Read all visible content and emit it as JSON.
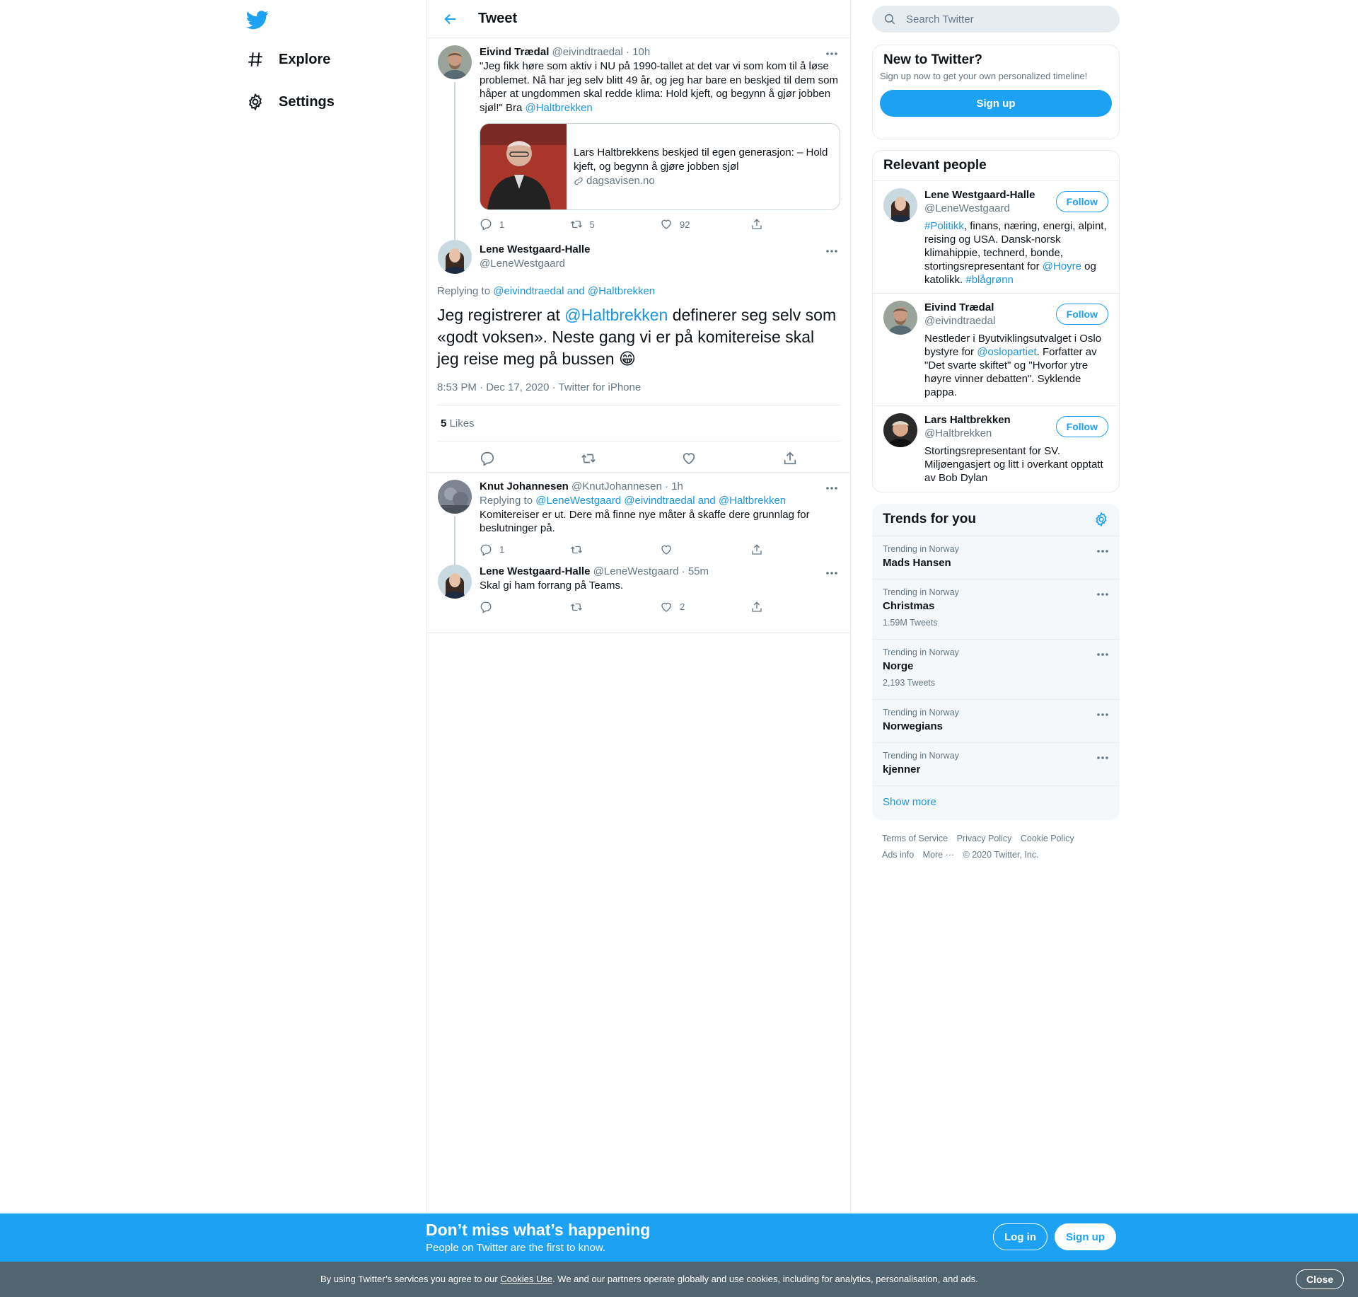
{
  "colors": {
    "accent": "#1da1f2",
    "link": "#1b95e0",
    "muted": "#657786",
    "border": "#e6ecf0",
    "cookie_bg": "#536471"
  },
  "nav": {
    "logo_icon": "twitter-bird-icon",
    "items": [
      {
        "label": "Explore",
        "icon": "hashtag-icon"
      },
      {
        "label": "Settings",
        "icon": "gear-icon"
      }
    ]
  },
  "header": {
    "title": "Tweet",
    "back_icon": "arrow-left-icon"
  },
  "parent_tweet": {
    "name": "Eivind Trædal",
    "handle": "@eivindtraedal",
    "time": "10h",
    "text": "\"Jeg fikk høre som aktiv i NU på 1990-tallet at det var vi som kom til å løse problemet. Nå har jeg selv blitt 49 år, og jeg har bare en beskjed til dem som håper at ungdommen skal redde klima: Hold kjeft, og begynn å gjør jobben sjøl!\" Bra ",
    "mention": "@Haltbrekken",
    "card": {
      "title": "Lars Haltbrekkens beskjed til egen generasjon: – Hold kjeft, og begynn å gjøre jobben sjøl",
      "domain": "dagsavisen.no"
    },
    "replies": "1",
    "retweets": "5",
    "likes": "92"
  },
  "focal_tweet": {
    "name": "Lene Westgaard-Halle",
    "handle": "@LeneWestgaard",
    "replying_prefix": "Replying to ",
    "replying_to": "@eivindtraedal and @Haltbrekken",
    "text_before": "Jeg registrerer at ",
    "mention": "@Haltbrekken",
    "text_after": " definerer seg selv som «godt voksen». Neste gang vi er på komitereise skal jeg reise meg på bussen ",
    "emoji": "😁",
    "timestamp": "8:53 PM · Dec 17, 2020 · Twitter for iPhone",
    "likes_count": "5",
    "likes_label": "Likes"
  },
  "replies": [
    {
      "name": "Knut Johannesen",
      "handle": "@KnutJohannesen",
      "time": "1h",
      "replying_prefix": "Replying to ",
      "replying_to": "@LeneWestgaard @eivindtraedal and @Haltbrekken",
      "text": "Komitereiser er ut. Dere må finne nye måter å skaffe dere grunnlag for beslutninger på.",
      "replies": "1",
      "retweets": "",
      "likes": ""
    },
    {
      "name": "Lene Westgaard-Halle",
      "handle": "@LeneWestgaard",
      "time": "55m",
      "text": "Skal gi ham forrang på Teams.",
      "replies": "",
      "retweets": "",
      "likes": "2"
    }
  ],
  "search": {
    "placeholder": "Search Twitter"
  },
  "new_to_twitter": {
    "title": "New to Twitter?",
    "subtitle": "Sign up now to get your own personalized timeline!",
    "button": "Sign up"
  },
  "relevant_people": {
    "title": "Relevant people",
    "follow_label": "Follow",
    "people": [
      {
        "name": "Lene Westgaard-Halle",
        "handle": "@LeneWestgaard",
        "bio_parts": [
          "#Politikk",
          ", finans, næring, energi, alpint, reising og USA. Dansk-norsk klimahippie, technerd, bonde, stortingsrepresentant for ",
          "@Hoyre",
          " og katolikk. ",
          "#blågrønn"
        ]
      },
      {
        "name": "Eivind Trædal",
        "handle": "@eivindtraedal",
        "bio_parts": [
          "Nestleder i Byutviklingsutvalget i Oslo bystyre for ",
          "@oslopartiet",
          ". Forfatter av \"Det svarte skiftet\" og \"Hvorfor ytre høyre vinner debatten\". Syklende pappa."
        ]
      },
      {
        "name": "Lars Haltbrekken",
        "handle": "@Haltbrekken",
        "bio": "Stortingsrepresentant for SV. Miljøengasjert og litt i overkant opptatt av Bob Dylan"
      }
    ]
  },
  "trends": {
    "title": "Trends for you",
    "items": [
      {
        "context": "Trending in Norway",
        "name": "Mads Hansen",
        "count": ""
      },
      {
        "context": "Trending in Norway",
        "name": "Christmas",
        "count": "1.59M Tweets"
      },
      {
        "context": "Trending in Norway",
        "name": "Norge",
        "count": "2,193 Tweets"
      },
      {
        "context": "Trending in Norway",
        "name": "Norwegians",
        "count": ""
      },
      {
        "context": "Trending in Norway",
        "name": "kjenner",
        "count": ""
      }
    ],
    "show_more": "Show more"
  },
  "footer": {
    "links": [
      "Terms of Service",
      "Privacy Policy",
      "Cookie Policy",
      "Ads info",
      "More ···"
    ],
    "copyright": "© 2020 Twitter, Inc."
  },
  "bottom_bar": {
    "title": "Don’t miss what’s happening",
    "subtitle": "People on Twitter are the first to know.",
    "login": "Log in",
    "signup": "Sign up"
  },
  "cookie_bar": {
    "text_before": "By using Twitter’s services you agree to our ",
    "link": "Cookies Use",
    "text_after": ". We and our partners operate globally and use cookies, including for analytics, personalisation, and ads.",
    "close": "Close"
  }
}
